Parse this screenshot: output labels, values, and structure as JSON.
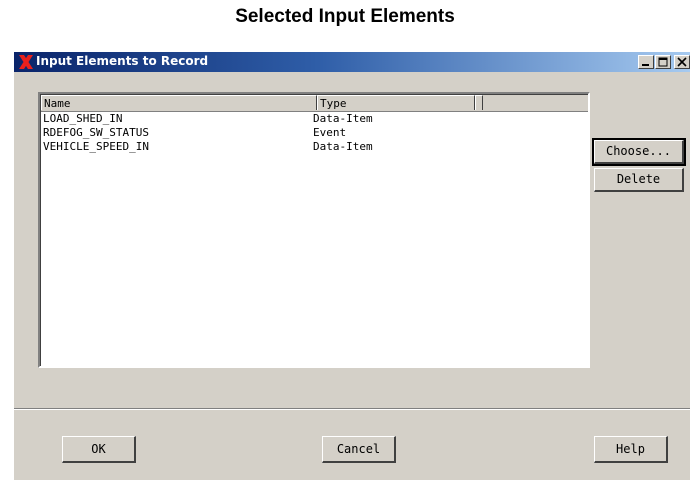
{
  "page": {
    "heading": "Selected Input Elements"
  },
  "window": {
    "title": "Input Elements to Record",
    "icon": "x-logo-icon",
    "controls": [
      "minimize-icon",
      "maximize-icon",
      "close-icon"
    ]
  },
  "list": {
    "columns": [
      "Name",
      "Type"
    ],
    "rows": [
      {
        "name": "LOAD_SHED_IN",
        "type": "Data-Item"
      },
      {
        "name": "RDEFOG_SW_STATUS",
        "type": "Event"
      },
      {
        "name": "VEHICLE_SPEED_IN",
        "type": "Data-Item"
      }
    ]
  },
  "side_buttons": {
    "choose": "Choose...",
    "delete": "Delete"
  },
  "footer_buttons": {
    "ok": "OK",
    "cancel": "Cancel",
    "help": "Help"
  },
  "colors": {
    "title_start": "#0a246a",
    "title_end": "#a6caf0",
    "face": "#d4d0c8",
    "logo_red": "#e8201c"
  }
}
